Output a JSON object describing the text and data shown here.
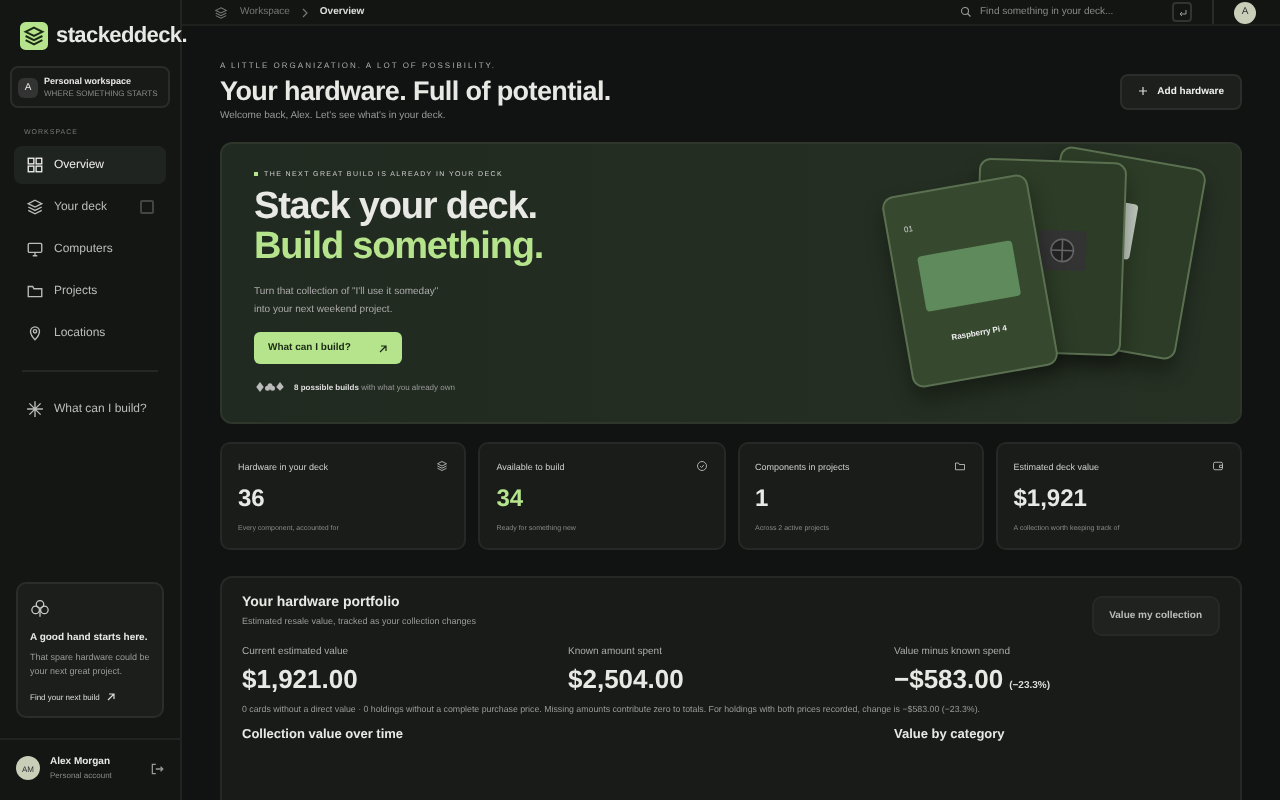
{
  "sidebar": {
    "brand": "stackeddeck.",
    "workspace": {
      "avatar": "A",
      "name": "Personal workspace",
      "subtitle": "WHERE SOMETHING STARTS"
    },
    "section_label": "WORKSPACE",
    "items": [
      {
        "label": "Overview",
        "selected": true
      },
      {
        "label": "Your deck",
        "selected": false,
        "shortcut": true
      },
      {
        "label": "Computers",
        "selected": false
      },
      {
        "label": "Projects",
        "selected": false
      },
      {
        "label": "Locations",
        "selected": false
      }
    ],
    "build_item": {
      "label": "What can I build?",
      "selected": false
    },
    "promo": {
      "title": "A good hand starts here.",
      "text": "That spare hardware could be your next great project.",
      "link": "Find your next build"
    },
    "user": {
      "initials": "AM",
      "name": "Alex Morgan",
      "subtitle": "Personal account"
    }
  },
  "topbar": {
    "breadcrumbs": [
      "Workspace",
      "Overview"
    ],
    "search": {
      "placeholder": "Find something in your deck..."
    },
    "avatar": "A"
  },
  "header": {
    "eyebrow": "A LITTLE ORGANIZATION. A LOT OF POSSIBILITY.",
    "title": "Your hardware. Full of potential.",
    "subtitle": "Welcome back, Alex. Let's see what's in your deck.",
    "button": "Add hardware"
  },
  "hero": {
    "eyebrow": "THE NEXT GREAT BUILD IS ALREADY IN YOUR DECK",
    "title_line_1": "Stack your deck.",
    "title_line_2": "Build something.",
    "text": "Turn that collection of \"I'll use it someday\" into your next weekend project.",
    "button": "What can I build?",
    "builds_count": "8 possible builds",
    "builds_text": "with what you already own",
    "card_index": "01",
    "card_title": "Raspberry Pi 4"
  },
  "stats": [
    {
      "label": "Hardware in your deck",
      "value": "36",
      "note": "Every component, accounted for",
      "highlight": false
    },
    {
      "label": "Available to build",
      "value": "34",
      "note": "Ready for something new",
      "highlight": true
    },
    {
      "label": "Components in projects",
      "value": "1",
      "note": "Across 2 active projects",
      "highlight": false
    },
    {
      "label": "Estimated deck value",
      "value": "$1,921",
      "note": "A collection worth keeping track of",
      "highlight": false
    }
  ],
  "portfolio": {
    "title": "Your hardware portfolio",
    "subtitle": "Estimated resale value, tracked as your collection changes",
    "button": "Value my collection",
    "metrics": [
      {
        "label": "Current estimated value",
        "value": "$1,921.00"
      },
      {
        "label": "Known amount spent",
        "value": "$2,504.00"
      },
      {
        "label": "Value minus known spend",
        "value": "−$583.00",
        "change": "(−23.3%)"
      }
    ],
    "note": "0 cards without a direct value · 0 holdings without a complete purchase price. Missing amounts contribute zero to totals. For holdings with both prices recorded, change is −$583.00 (−23.3%).",
    "sections": [
      "Collection value over time",
      "Value by category"
    ]
  }
}
